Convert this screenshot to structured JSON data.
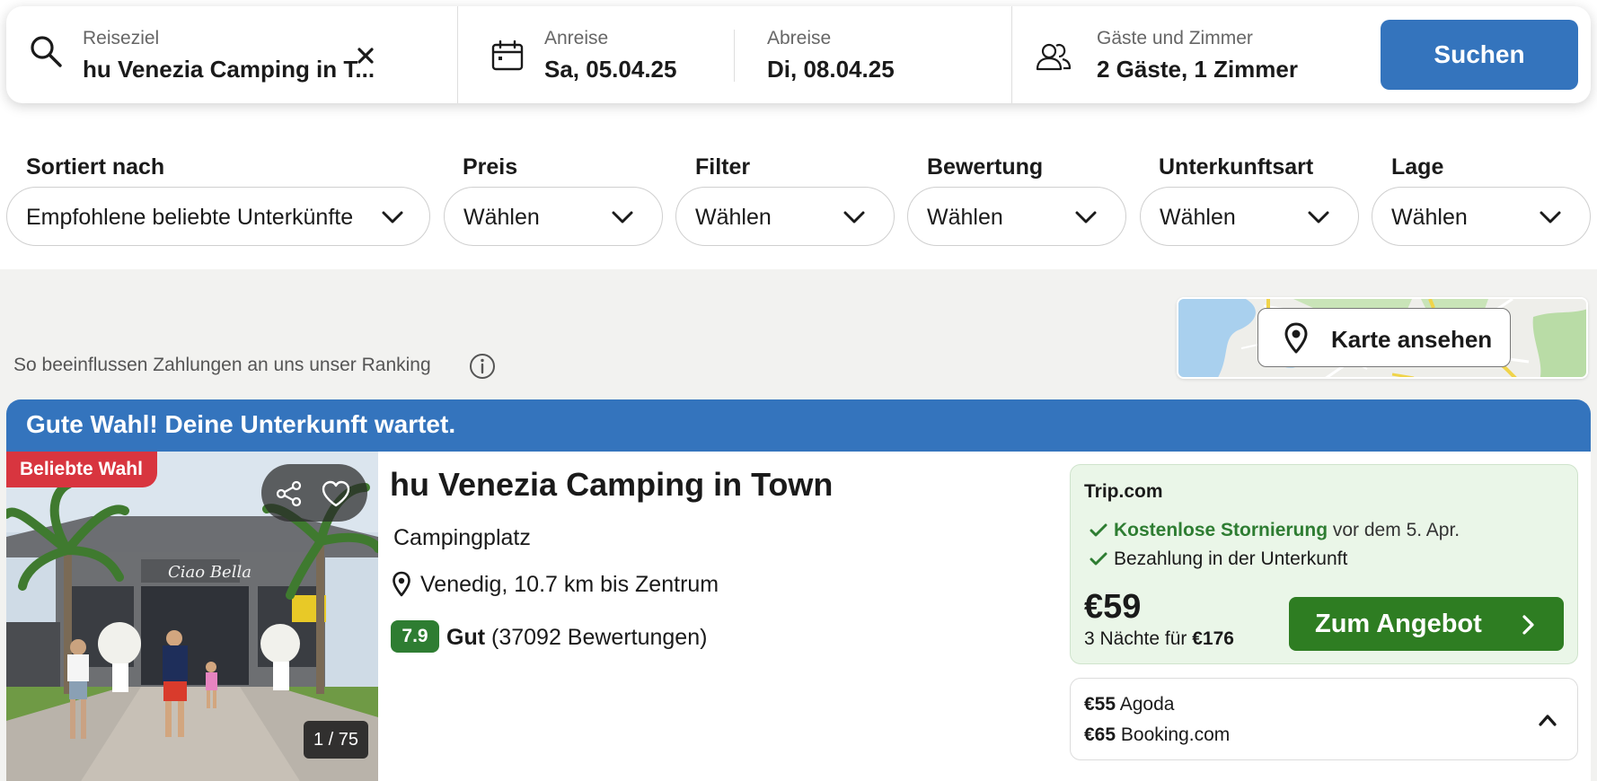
{
  "search": {
    "destination_label": "Reiseziel",
    "destination_value": "hu Venezia Camping in T...",
    "checkin_label": "Anreise",
    "checkin_value": "Sa, 05.04.25",
    "checkout_label": "Abreise",
    "checkout_value": "Di, 08.04.25",
    "guests_label": "Gäste und Zimmer",
    "guests_value": "2 Gäste, 1 Zimmer",
    "search_button": "Suchen"
  },
  "filters": [
    {
      "label": "Sortiert nach",
      "value": "Empfohlene beliebte Unterkünfte"
    },
    {
      "label": "Preis",
      "value": "Wählen"
    },
    {
      "label": "Filter",
      "value": "Wählen"
    },
    {
      "label": "Bewertung",
      "value": "Wählen"
    },
    {
      "label": "Unterkunftsart",
      "value": "Wählen"
    },
    {
      "label": "Lage",
      "value": "Wählen"
    }
  ],
  "ranking_note": "So beeinflussen Zahlungen an uns unser Ranking",
  "map_button": "Karte ansehen",
  "result": {
    "banner": "Gute Wahl! Deine Unterkunft wartet.",
    "badge": "Beliebte Wahl",
    "photo_counter": "1 / 75",
    "name": "hu Venezia Camping in Town",
    "type": "Campingplatz",
    "location": "Venedig, 10.7 km bis Zentrum",
    "rating_score": "7.9",
    "rating_label": "Gut",
    "rating_count": "(37092 Bewertungen)",
    "offer": {
      "provider": "Trip.com",
      "free_cancel": "Kostenlose Stornierung",
      "free_cancel_suffix": "vor dem 5. Apr.",
      "pay_at_property": "Bezahlung in der Unterkunft",
      "price": "€59",
      "nights_text": "3 Nächte für",
      "total": "€176",
      "button": "Zum Angebot"
    },
    "alternatives": [
      {
        "price": "€55",
        "provider": "Agoda"
      },
      {
        "price": "€65",
        "provider": "Booking.com"
      }
    ]
  },
  "colors": {
    "brand_blue": "#3474bd",
    "deal_green": "#2e7d22",
    "rating_green": "#2e7d32",
    "badge_red": "#d8353f",
    "offer_bg": "#eaf6e8"
  },
  "icons": [
    "search-icon",
    "clear-icon",
    "calendar-icon",
    "guests-icon",
    "chevron-down-icon",
    "info-icon",
    "map-pin-icon",
    "share-icon",
    "heart-icon",
    "check-icon",
    "chevron-right-icon",
    "chevron-up-icon"
  ]
}
